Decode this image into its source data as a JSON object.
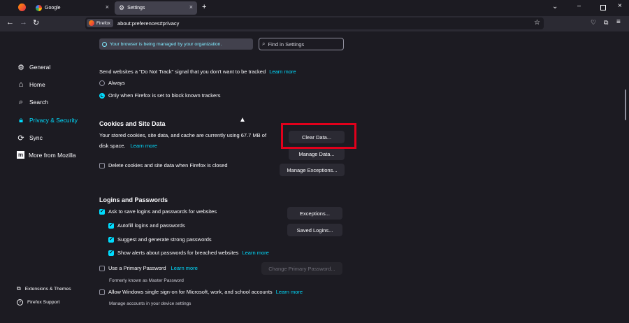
{
  "tabs": [
    {
      "label": "Google"
    },
    {
      "label": "Settings"
    }
  ],
  "url": {
    "identity_label": "Firefox",
    "address": "about:preferences#privacy"
  },
  "banner": {
    "text": "Your browser is being managed by your organization."
  },
  "search": {
    "placeholder": "Find in Settings"
  },
  "sidebar": {
    "items": [
      {
        "label": "General"
      },
      {
        "label": "Home"
      },
      {
        "label": "Search"
      },
      {
        "label": "Privacy & Security"
      },
      {
        "label": "Sync"
      },
      {
        "label": "More from Mozilla"
      }
    ],
    "footer": [
      {
        "label": "Extensions & Themes"
      },
      {
        "label": "Firefox Support"
      }
    ]
  },
  "dnt": {
    "text": "Send websites a \"Do Not Track\" signal that you don't want to be tracked",
    "learn_more": "Learn more",
    "options": [
      {
        "label": "Always",
        "selected": false
      },
      {
        "label": "Only when Firefox is set to block known trackers",
        "selected": true
      }
    ]
  },
  "cookies": {
    "heading": "Cookies and Site Data",
    "desc_line1": "Your stored cookies, site data, and cache are currently using 67.7 MB of",
    "desc_line2": "disk space.",
    "learn_more": "Learn more",
    "delete_label": "Delete cookies and site data when Firefox is closed",
    "clear_button": "Clear Data...",
    "manage_button": "Manage Data...",
    "exceptions_button": "Manage Exceptions..."
  },
  "logins": {
    "heading": "Logins and Passwords",
    "ask_save": "Ask to save logins and passwords for websites",
    "autofill": "Autofill logins and passwords",
    "suggest": "Suggest and generate strong passwords",
    "alerts": "Show alerts about passwords for breached websites",
    "alerts_learn_more": "Learn more",
    "primary_password": "Use a Primary Password",
    "primary_learn_more": "Learn more",
    "primary_sub": "Formerly known as Master Password",
    "windows_sso": "Allow Windows single sign-on for Microsoft, work, and school accounts",
    "windows_learn_more": "Learn more",
    "windows_sub": "Manage accounts in your device settings",
    "exceptions_button": "Exceptions...",
    "saved_logins_button": "Saved Logins...",
    "change_primary_button": "Change Primary Password..."
  },
  "colors": {
    "accent": "#00ddff",
    "highlight": "#e1001b",
    "background": "#1c1b22"
  }
}
